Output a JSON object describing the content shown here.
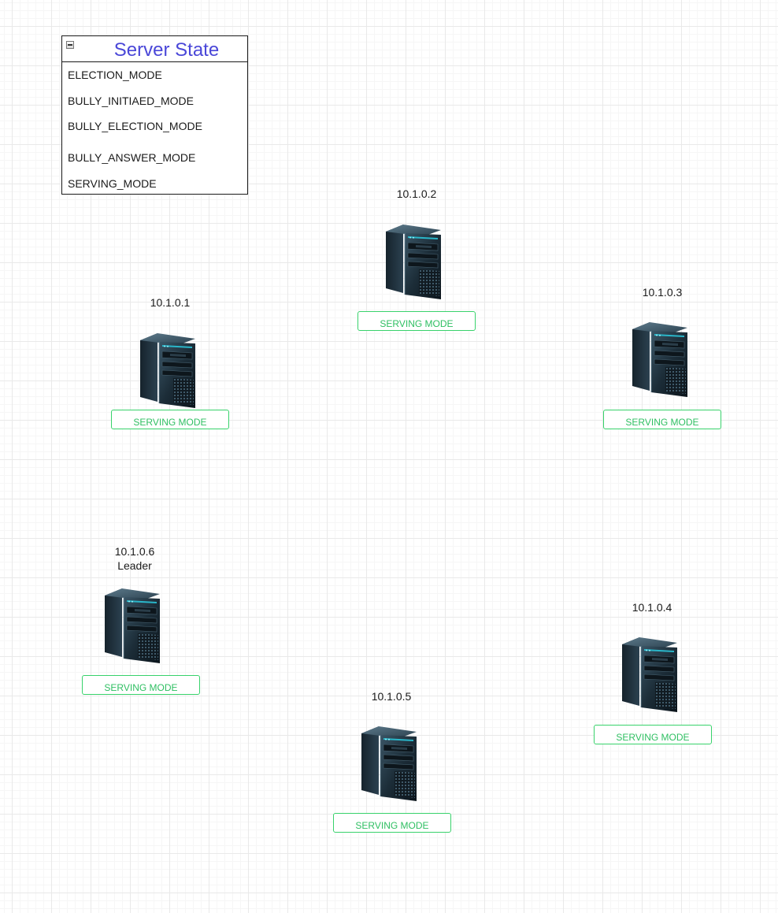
{
  "legend": {
    "title": "Server State",
    "states": [
      "ELECTION_MODE",
      "BULLY_INITIAED_MODE",
      "BULLY_ELECTION_MODE",
      "BULLY_ANSWER_MODE",
      "SERVING_MODE"
    ],
    "title_color": "#4a47d8"
  },
  "nodes": [
    {
      "ip": "10.1.0.1",
      "status": "SERVING MODE"
    },
    {
      "ip": "10.1.0.2",
      "status": "SERVING MODE"
    },
    {
      "ip": "10.1.0.3",
      "status": "SERVING MODE"
    },
    {
      "ip": "10.1.0.4",
      "status": "SERVING MODE"
    },
    {
      "ip": "10.1.0.5",
      "status": "SERVING MODE"
    },
    {
      "ip": "10.1.0.6",
      "role": "Leader",
      "status": "SERVING MODE"
    }
  ],
  "status_color": "#2fbf62",
  "icons": {
    "server": "server-tower-icon",
    "collapse": "collapse-minus-icon"
  }
}
